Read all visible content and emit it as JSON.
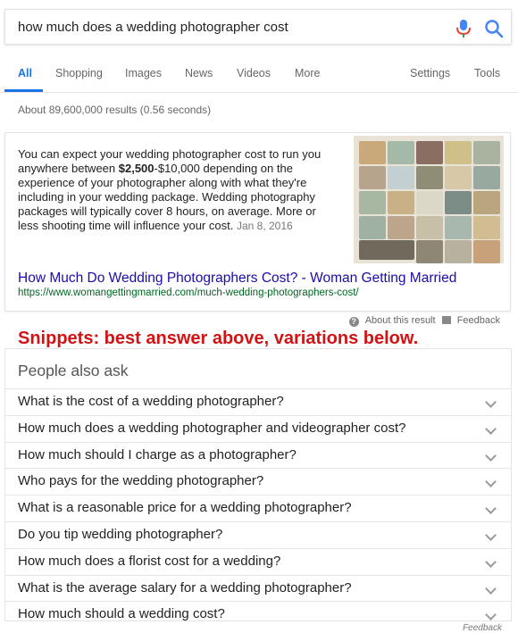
{
  "search": {
    "query": "how much does a wedding photographer cost"
  },
  "tabs": [
    {
      "label": "All"
    },
    {
      "label": "Shopping"
    },
    {
      "label": "Images"
    },
    {
      "label": "News"
    },
    {
      "label": "Videos"
    },
    {
      "label": "More"
    },
    {
      "label": "Settings"
    },
    {
      "label": "Tools"
    }
  ],
  "stats": "About 89,600,000 results (0.56 seconds)",
  "snippet": {
    "text_before": "You can expect your wedding photographer cost to run you anywhere between ",
    "text_bold": "$2,500",
    "text_after": "-$10,000 depending on the experience of your photographer along with what they're including in your wedding package. Wedding photography packages will typically cover 8 hours, on average. More or less shooting time will influence your cost.",
    "date": "Jan 8, 2016",
    "title": "How Much Do Wedding Photographers Cost? - Woman Getting Married",
    "url": "https://www.womangettingmarried.com/much-wedding-photographers-cost/"
  },
  "about": {
    "about_label": "About this result",
    "feedback_label": "Feedback"
  },
  "annotation": "Snippets: best answer above, variations below.",
  "paa": {
    "title": "People also ask",
    "questions": [
      "What is the cost of a wedding photographer?",
      "How much does a wedding photographer and videographer cost?",
      "How much should I charge as a photographer?",
      "Who pays for the wedding photographer?",
      "What is a reasonable price for a wedding photographer?",
      "Do you tip wedding photographer?",
      "How much does a florist cost for a wedding?",
      "What is the average salary for a wedding photographer?",
      "How much should a wedding cost?"
    ]
  },
  "feedback_bottom": "Feedback",
  "colors": {
    "accent": "#1a73e8",
    "link": "#1a0dab",
    "url": "#006621",
    "annotation": "#d31313"
  },
  "icons": [
    "microphone-icon",
    "search-icon",
    "question-icon",
    "feedback-icon",
    "chevron-down-icon"
  ]
}
